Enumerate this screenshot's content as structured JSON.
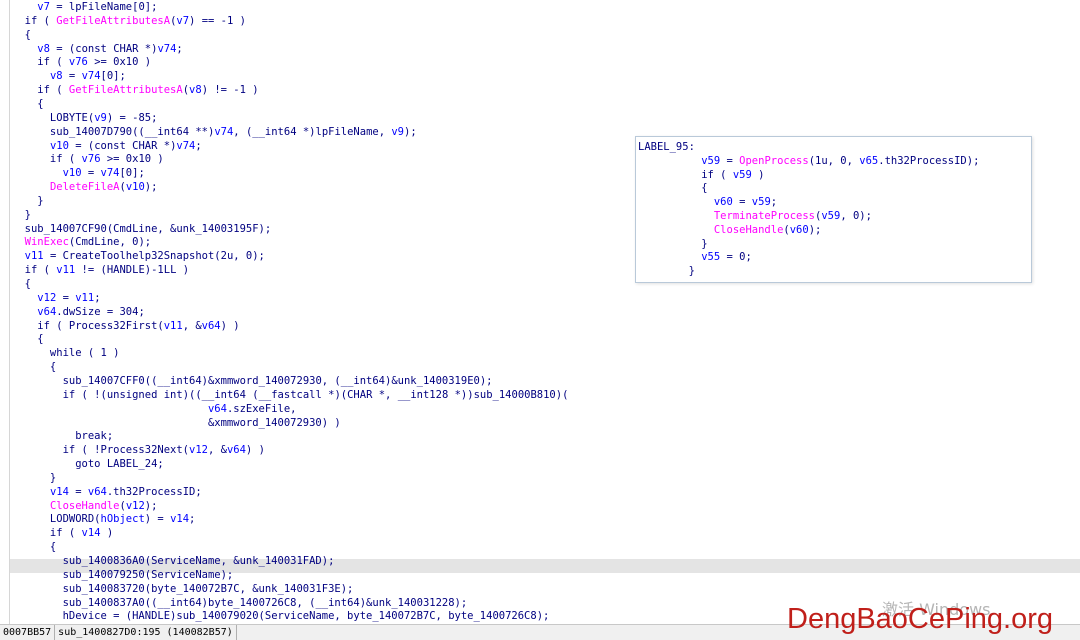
{
  "code_lines": [
    {
      "text": "    v7 = lpFileName[0];"
    },
    {
      "text": "  if ( GetFileAttributesA(v7) == -1 )"
    },
    {
      "text": "  {"
    },
    {
      "text": "    v8 = (const CHAR *)v74;"
    },
    {
      "text": "    if ( v76 >= 0x10 )"
    },
    {
      "text": "      v8 = v74[0];"
    },
    {
      "text": "    if ( GetFileAttributesA(v8) != -1 )"
    },
    {
      "text": "    {"
    },
    {
      "text": "      LOBYTE(v9) = -85;"
    },
    {
      "text": "      sub_14007D790((__int64 **)v74, (__int64 *)lpFileName, v9);"
    },
    {
      "text": "      v10 = (const CHAR *)v74;"
    },
    {
      "text": "      if ( v76 >= 0x10 )"
    },
    {
      "text": "        v10 = v74[0];"
    },
    {
      "text": "      DeleteFileA(v10);"
    },
    {
      "text": "    }"
    },
    {
      "text": "  }"
    },
    {
      "text": "  sub_14007CF90(CmdLine, &unk_14003195F);"
    },
    {
      "text": "  WinExec(CmdLine, 0);"
    },
    {
      "text": "  v11 = CreateToolhelp32Snapshot(2u, 0);"
    },
    {
      "text": "  if ( v11 != (HANDLE)-1LL )"
    },
    {
      "text": "  {"
    },
    {
      "text": "    v12 = v11;"
    },
    {
      "text": "    v64.dwSize = 304;"
    },
    {
      "text": "    if ( Process32First(v11, &v64) )"
    },
    {
      "text": "    {"
    },
    {
      "text": "      while ( 1 )"
    },
    {
      "text": "      {"
    },
    {
      "text": "        sub_14007CFF0((__int64)&xmmword_140072930, (__int64)&unk_1400319E0);"
    },
    {
      "text": "        if ( !(unsigned int)((__int64 (__fastcall *)(CHAR *, __int128 *))sub_14000B810)("
    },
    {
      "text": "                               v64.szExeFile,"
    },
    {
      "text": "                               &xmmword_140072930) )"
    },
    {
      "text": "          break;"
    },
    {
      "text": "        if ( !Process32Next(v12, &v64) )"
    },
    {
      "text": "          goto LABEL_24;"
    },
    {
      "text": "      }"
    },
    {
      "text": "      v14 = v64.th32ProcessID;"
    },
    {
      "text": "      CloseHandle(v12);"
    },
    {
      "text": "      LODWORD(hObject) = v14;"
    },
    {
      "text": "      if ( v14 )"
    },
    {
      "text": "      {"
    },
    {
      "text": "        sub_1400836A0(ServiceName, &unk_140031FAD);"
    },
    {
      "text": "        sub_140079250(ServiceName);"
    },
    {
      "text": "        sub_140083720(byte_140072B7C, &unk_140031F3E);"
    },
    {
      "text": "        sub_1400837A0((__int64)byte_1400726C8, (__int64)&unk_140031228);"
    },
    {
      "text": "        hDevice = (HANDLE)sub_140079020(ServiceName, byte_140072B7C, byte_1400726C8);"
    }
  ],
  "highlighted_line_index": 40,
  "popup": {
    "lines": [
      {
        "text": "LABEL_95:"
      },
      {
        "text": "          v59 = OpenProcess(1u, 0, v65.th32ProcessID);"
      },
      {
        "text": "          if ( v59 )"
      },
      {
        "text": "          {"
      },
      {
        "text": "            v60 = v59;"
      },
      {
        "text": "            TerminateProcess(v59, 0);"
      },
      {
        "text": "            CloseHandle(v60);"
      },
      {
        "text": "          }"
      },
      {
        "text": "          v55 = 0;"
      },
      {
        "text": "        }"
      }
    ]
  },
  "status_bar": {
    "address": "0007BB57",
    "location": "sub_1400827D0:195 (140082B57)"
  },
  "windows_activation_text": "激活 Windows",
  "watermark_text": "DengBaoCePing.org"
}
